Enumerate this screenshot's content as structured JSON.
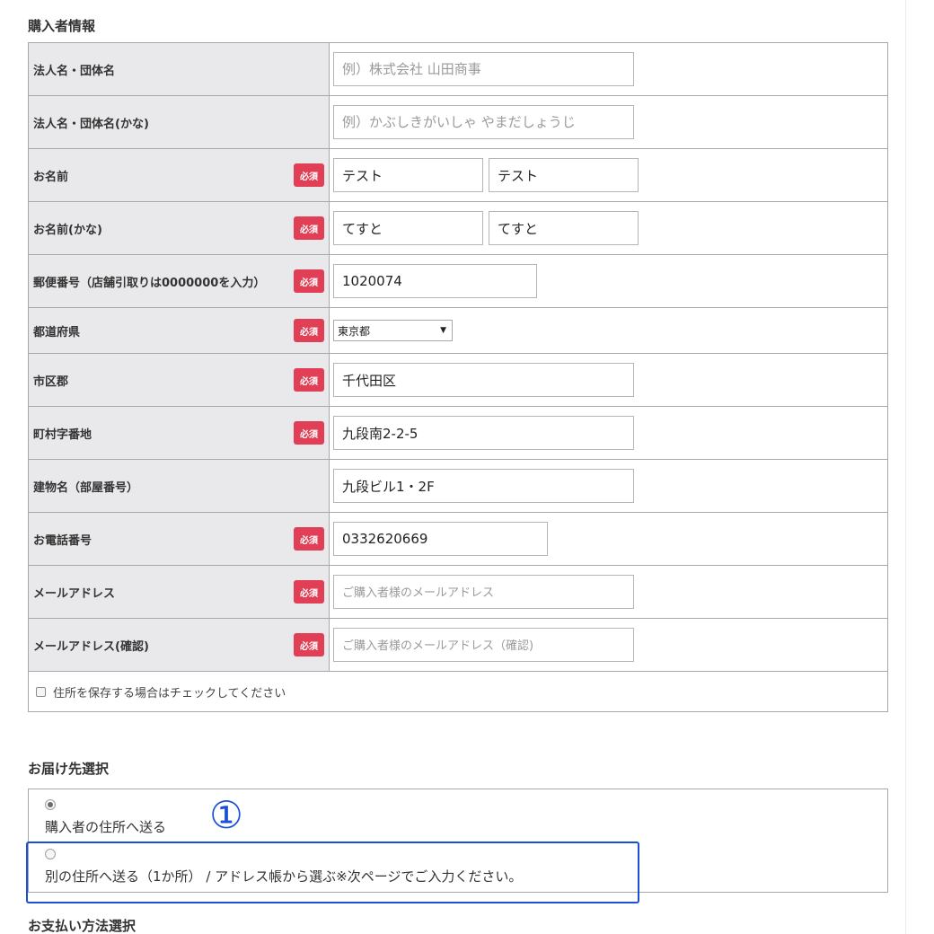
{
  "buyer_section": {
    "title": "購入者情報",
    "rows": [
      {
        "label": "法人名・団体名",
        "required": false,
        "fields": [
          {
            "value": "",
            "placeholder": "例）株式会社 山田商事"
          }
        ]
      },
      {
        "label": "法人名・団体名(かな)",
        "required": false,
        "fields": [
          {
            "value": "",
            "placeholder": "例）かぶしきがいしゃ やまだしょうじ"
          }
        ]
      },
      {
        "label": "お名前",
        "required": true,
        "fields": [
          {
            "value": "テスト",
            "placeholder": ""
          },
          {
            "value": "テスト",
            "placeholder": ""
          }
        ]
      },
      {
        "label": "お名前(かな)",
        "required": true,
        "fields": [
          {
            "value": "てすと",
            "placeholder": ""
          },
          {
            "value": "てすと",
            "placeholder": ""
          }
        ]
      },
      {
        "label": "郵便番号（店舗引取りは0000000を入力）",
        "required": true,
        "fields": [
          {
            "value": "1020074",
            "placeholder": ""
          }
        ]
      },
      {
        "label": "都道府県",
        "required": true,
        "select": {
          "selected": "東京都"
        }
      },
      {
        "label": "市区郡",
        "required": true,
        "fields": [
          {
            "value": "千代田区",
            "placeholder": ""
          }
        ]
      },
      {
        "label": "町村字番地",
        "required": true,
        "fields": [
          {
            "value": "九段南2-2-5",
            "placeholder": ""
          }
        ]
      },
      {
        "label": "建物名（部屋番号）",
        "required": false,
        "fields": [
          {
            "value": "九段ビル1・2F",
            "placeholder": ""
          }
        ]
      },
      {
        "label": "お電話番号",
        "required": true,
        "fields": [
          {
            "value": "0332620669",
            "placeholder": ""
          }
        ]
      },
      {
        "label": "メールアドレス",
        "required": true,
        "fields": [
          {
            "value": "",
            "placeholder": "ご購入者様のメールアドレス"
          }
        ]
      },
      {
        "label": "メールアドレス(確認)",
        "required": true,
        "fields": [
          {
            "value": "",
            "placeholder": "ご購入者様のメールアドレス（確認)"
          }
        ]
      }
    ],
    "required_badge": "必須",
    "save_address_label": "住所を保存する場合はチェックしてください",
    "save_address_checked": false
  },
  "delivery_section": {
    "title": "お届け先選択",
    "options": [
      {
        "label": "購入者の住所へ送る",
        "selected": true
      },
      {
        "label": "別の住所へ送る（1か所） / アドレス帳から選ぶ※次ページでご入力ください。",
        "selected": false
      }
    ]
  },
  "annotation": {
    "marker": "①",
    "color": "#1a4fd6"
  },
  "payment_section": {
    "title": "お支払い方法選択"
  },
  "colors": {
    "badge": "#e13f55",
    "label_bg": "#e9e9eb",
    "border": "#a8a8a8",
    "highlight": "#1a4fd6"
  }
}
